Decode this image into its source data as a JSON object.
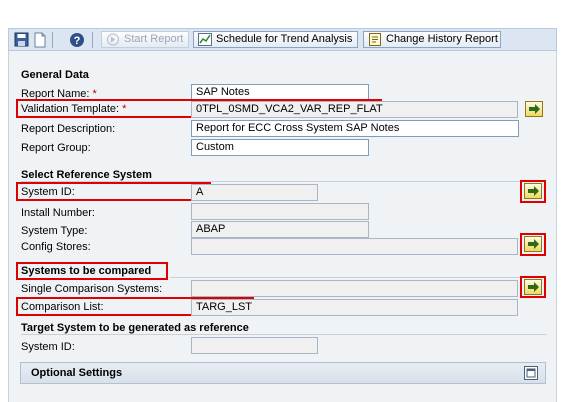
{
  "toolbar": {
    "save_icon": "save-icon",
    "new_icon": "document-icon",
    "help_icon": "help-icon",
    "start_report": "Start Report",
    "schedule": "Schedule for Trend Analysis",
    "change_history": "Change History Report"
  },
  "general": {
    "heading": "General Data",
    "report_name_label": "Report Name:",
    "report_name_value": "SAP Notes",
    "validation_label": "Validation Template:",
    "validation_value": "0TPL_0SMD_VCA2_VAR_REP_FLAT",
    "description_label": "Report Description:",
    "description_value": "Report for ECC Cross System SAP Notes",
    "group_label": "Report Group:",
    "group_value": "Custom",
    "required_marker": "*"
  },
  "reference": {
    "heading": "Select Reference System",
    "system_id_label": "System ID:",
    "system_id_value": "A",
    "install_label": "Install Number:",
    "install_value": "",
    "type_label": "System Type:",
    "type_value": "ABAP",
    "config_label": "Config Stores:",
    "config_value": ""
  },
  "compared": {
    "heading": "Systems to be compared",
    "single_label": "Single Comparison Systems:",
    "single_value": "",
    "list_label": "Comparison List:",
    "list_value": "TARG_LST"
  },
  "target": {
    "heading": "Target System to be generated as reference",
    "system_id_label": "System ID:",
    "system_id_value": ""
  },
  "optional": {
    "label": "Optional Settings"
  },
  "colors": {
    "highlight": "#e00000",
    "required": "#c00000"
  }
}
